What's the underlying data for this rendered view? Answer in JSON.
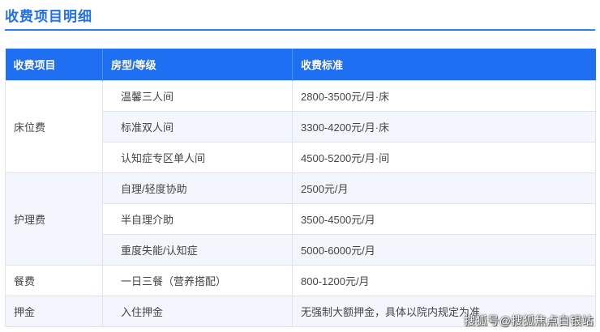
{
  "title": "收费项目明细",
  "table": {
    "headers": [
      "收费项目",
      "房型/等级",
      "收费标准"
    ],
    "groups": [
      {
        "category": "床位费",
        "rows": [
          {
            "item": "温馨三人间",
            "price": "2800-3500元/月·床"
          },
          {
            "item": "标准双人间",
            "price": "3300-4200元/月·床"
          },
          {
            "item": "认知症专区单人间",
            "price": "4500-5200元/月·间"
          }
        ]
      },
      {
        "category": "护理费",
        "rows": [
          {
            "item": "自理/轻度协助",
            "price": "2500元/月"
          },
          {
            "item": "半自理介助",
            "price": "3500-4500元/月"
          },
          {
            "item": "重度失能/认知症",
            "price": "5000-6000元/月"
          }
        ]
      },
      {
        "category": "餐费",
        "rows": [
          {
            "item": "一日三餐（营养搭配）",
            "price": "800-1200元/月"
          }
        ]
      },
      {
        "category": "押金",
        "rows": [
          {
            "item": "入住押金",
            "price": "无强制大额押金，具体以院内规定为准"
          }
        ]
      }
    ]
  },
  "watermark": "搜狐号@搜狐焦点白银站",
  "colors": {
    "accent": "#1f6ff2",
    "row_shade": "#f3f7fd",
    "border": "#dbe4ef"
  }
}
